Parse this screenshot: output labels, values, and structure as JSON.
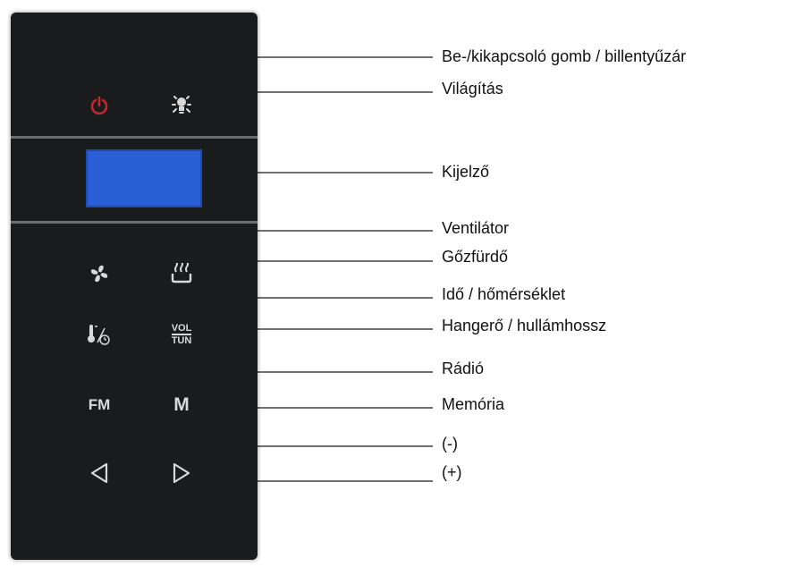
{
  "panel": {
    "display_color": "#2a5fd6",
    "buttons": {
      "power": {
        "icon": "power-icon",
        "color": "#c0282d"
      },
      "light": {
        "icon": "light-bulb-icon"
      },
      "fan": {
        "icon": "fan-icon"
      },
      "steam": {
        "icon": "steam-bath-icon"
      },
      "time_temp": {
        "icon": "clock-thermometer-icon"
      },
      "vol_top": "VOL",
      "vol_bottom": "TUN",
      "fm": "FM",
      "memory": "M",
      "minus": {
        "icon": "left-triangle-icon"
      },
      "plus": {
        "icon": "right-triangle-icon"
      }
    }
  },
  "callouts": [
    {
      "id": "power",
      "label": "Be-/kikapcsoló gomb / billentyűzár"
    },
    {
      "id": "light",
      "label": "Világítás"
    },
    {
      "id": "display",
      "label": "Kijelző"
    },
    {
      "id": "fan",
      "label": "Ventilátor"
    },
    {
      "id": "steam",
      "label": "Gőzfürdő"
    },
    {
      "id": "time",
      "label": "Idő / hőmérséklet"
    },
    {
      "id": "volume",
      "label": "Hangerő / hullámhossz"
    },
    {
      "id": "radio",
      "label": "Rádió"
    },
    {
      "id": "memory",
      "label": "Memória"
    },
    {
      "id": "minus",
      "label": "(-)"
    },
    {
      "id": "plus",
      "label": "(+)"
    }
  ]
}
